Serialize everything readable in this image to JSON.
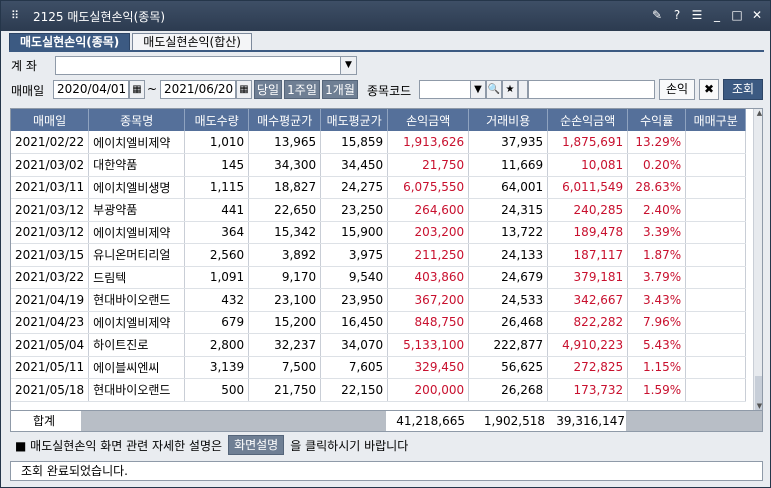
{
  "window": {
    "title": "2125 매도실현손익(종목)"
  },
  "tabs": [
    {
      "label": "매도실현손익(종목)"
    },
    {
      "label": "매도실현손익(합산)"
    }
  ],
  "form": {
    "account_label": "계  좌",
    "sell_date_label": "매매일",
    "date_from": "2020/04/01",
    "date_sep": "~",
    "date_to": "2021/06/20",
    "btn_today": "당일",
    "btn_1week": "1주일",
    "btn_1month": "1개월",
    "stock_code_label": "종목코드",
    "btn_pnl": "손익",
    "btn_search": "조회"
  },
  "table": {
    "headers": [
      "매매일",
      "종목명",
      "매도수량",
      "매수평균가",
      "매도평균가",
      "손익금액",
      "거래비용",
      "순손익금액",
      "수익률",
      "매매구분"
    ],
    "rows": [
      [
        "2021/02/22",
        "에이치엘비제약",
        "1,010",
        "13,965",
        "15,859",
        "1,913,626",
        "37,935",
        "1,875,691",
        "13.29%",
        ""
      ],
      [
        "2021/03/02",
        "대한약품",
        "145",
        "34,300",
        "34,450",
        "21,750",
        "11,669",
        "10,081",
        "0.20%",
        ""
      ],
      [
        "2021/03/11",
        "에이치엘비생명",
        "1,115",
        "18,827",
        "24,275",
        "6,075,550",
        "64,001",
        "6,011,549",
        "28.63%",
        ""
      ],
      [
        "2021/03/12",
        "부광약품",
        "441",
        "22,650",
        "23,250",
        "264,600",
        "24,315",
        "240,285",
        "2.40%",
        ""
      ],
      [
        "2021/03/12",
        "에이치엘비제약",
        "364",
        "15,342",
        "15,900",
        "203,200",
        "13,722",
        "189,478",
        "3.39%",
        ""
      ],
      [
        "2021/03/15",
        "유니온머티리얼",
        "2,560",
        "3,892",
        "3,975",
        "211,250",
        "24,133",
        "187,117",
        "1.87%",
        ""
      ],
      [
        "2021/03/22",
        "드림텍",
        "1,091",
        "9,170",
        "9,540",
        "403,860",
        "24,679",
        "379,181",
        "3.79%",
        ""
      ],
      [
        "2021/04/19",
        "현대바이오랜드",
        "432",
        "23,100",
        "23,950",
        "367,200",
        "24,533",
        "342,667",
        "3.43%",
        ""
      ],
      [
        "2021/04/23",
        "에이치엘비제약",
        "679",
        "15,200",
        "16,450",
        "848,750",
        "26,468",
        "822,282",
        "7.96%",
        ""
      ],
      [
        "2021/05/04",
        "하이트진로",
        "2,800",
        "32,237",
        "34,070",
        "5,133,100",
        "222,877",
        "4,910,223",
        "5.43%",
        ""
      ],
      [
        "2021/05/11",
        "에이블씨엔씨",
        "3,139",
        "7,500",
        "7,605",
        "329,450",
        "56,625",
        "272,825",
        "1.15%",
        ""
      ],
      [
        "2021/05/18",
        "현대바이오랜드",
        "500",
        "21,750",
        "22,150",
        "200,000",
        "26,268",
        "173,732",
        "1.59%",
        ""
      ]
    ]
  },
  "totals": {
    "label": "합계",
    "pnl": "41,218,665",
    "cost": "1,902,518",
    "net": "39,316,147"
  },
  "help": {
    "prefix": "■ 매도실현손익 화면 관련 자세한 설명은",
    "button": "화면설명",
    "suffix": "을 클릭하시기 바랍니다"
  },
  "status": {
    "text": "조회 완료되었습니다."
  },
  "colors": {
    "header": "#55709a",
    "profit": "#c8102e",
    "accent": "#3c5a82"
  }
}
